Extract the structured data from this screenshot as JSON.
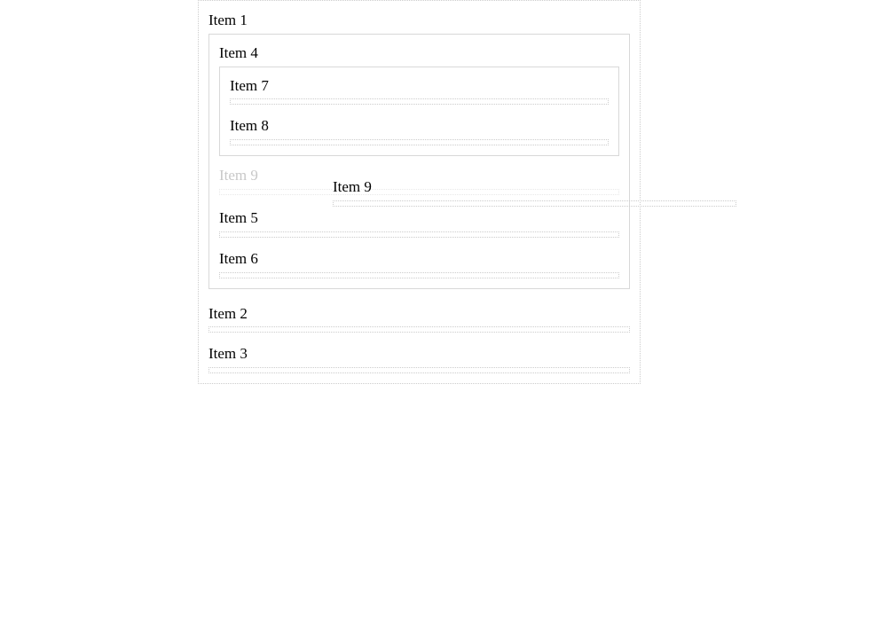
{
  "root": {
    "item1": "Item 1",
    "item2": "Item 2",
    "item3": "Item 3",
    "nested1": {
      "item4": "Item 4",
      "item5": "Item 5",
      "item6": "Item 6",
      "item9_ghost": "Item 9",
      "nested2": {
        "item7": "Item 7",
        "item8": "Item 8"
      }
    }
  },
  "overlay": {
    "item9": "Item 9"
  }
}
